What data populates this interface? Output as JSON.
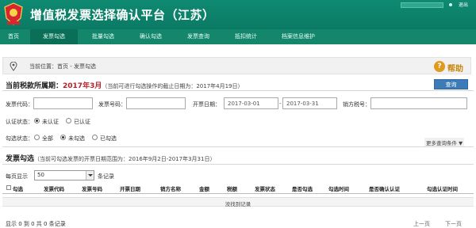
{
  "header": {
    "title": "增值税发票选择确认平台（江苏）",
    "logout": "退出",
    "accent": "#0f8a72"
  },
  "nav": {
    "items": [
      {
        "label": "首页"
      },
      {
        "label": "发票勾选",
        "active": true
      },
      {
        "label": "批量勾选"
      },
      {
        "label": "确认勾选"
      },
      {
        "label": "发票查询"
      },
      {
        "label": "抵扣统计"
      },
      {
        "label": "档案信息维护"
      }
    ]
  },
  "breadcrumb": {
    "text": "当前位置：首页 - 发票勾选"
  },
  "help": {
    "label": "帮助"
  },
  "period": {
    "label": "当前税款所属期：",
    "month": "2017年3月",
    "note": "（当前可进行勾选操作的截止日期为：2017年4月19日）"
  },
  "query_button": "查询",
  "form": {
    "invoice_code_label": "发票代码：",
    "invoice_code_value": "",
    "invoice_number_label": "发票号码：",
    "invoice_number_value": "",
    "issue_date_label": "开票日期：",
    "date_from": "2017-03-01",
    "date_sep": "-",
    "date_to": "2017-03-31",
    "seller_tax_label": "销方税号：",
    "seller_tax_value": "",
    "cert_status_label": "认证状态：",
    "cert_options": [
      "未认证",
      "已认证"
    ],
    "cert_selected": "未认证",
    "select_status_label": "勾选状态：",
    "select_options": [
      "全部",
      "未勾选",
      "已勾选"
    ],
    "select_selected": "未勾选",
    "more_conditions": "更多查询条件 ▼"
  },
  "section": {
    "title": "发票勾选",
    "note": "（当前可勾选发票的开票日期范围为：2016年9月2日-2017年3月31日）"
  },
  "paging": {
    "per_page_label": "每页显示",
    "per_page_value": "50",
    "per_page_unit": "条记录",
    "info": "显示 0 到 0 共 0 条记录",
    "prev": "上一页",
    "next": "下一页"
  },
  "table": {
    "columns": [
      "勾选",
      "发票代码",
      "发票号码",
      "开票日期",
      "销方名称",
      "金额",
      "税额",
      "发票状态",
      "是否勾选",
      "勾选时间",
      "是否确认认证",
      "勾选认证时间"
    ],
    "empty_text": "没找到记录"
  }
}
